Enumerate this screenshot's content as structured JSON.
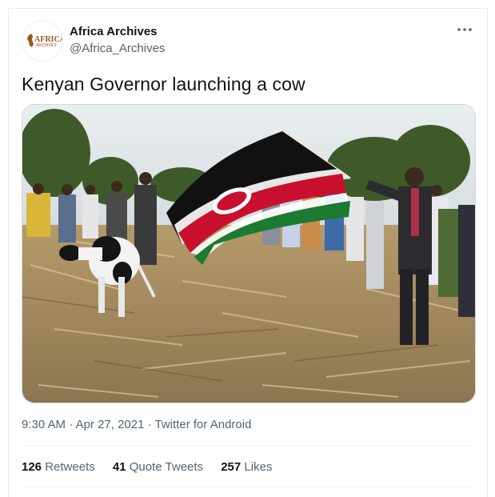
{
  "author": {
    "name": "Africa Archives",
    "handle": "@Africa_Archives",
    "avatar_logo_text": "AFRICA ARCHIVES"
  },
  "tweet": {
    "text": "Kenyan Governor launching a cow"
  },
  "meta": {
    "time": "9:30 AM",
    "date": "Apr 27, 2021",
    "separator": "·",
    "source": "Twitter for Android"
  },
  "stats": {
    "retweets_count": "126",
    "retweets_label": "Retweets",
    "quotes_count": "41",
    "quotes_label": "Quote Tweets",
    "likes_count": "257",
    "likes_label": "Likes"
  },
  "colors": {
    "text_primary": "#0f1419",
    "text_secondary": "#536471",
    "border": "#e6ecf0",
    "logo_brown": "#a0581f"
  },
  "icons": {
    "more": "more-horizontal-icon"
  }
}
